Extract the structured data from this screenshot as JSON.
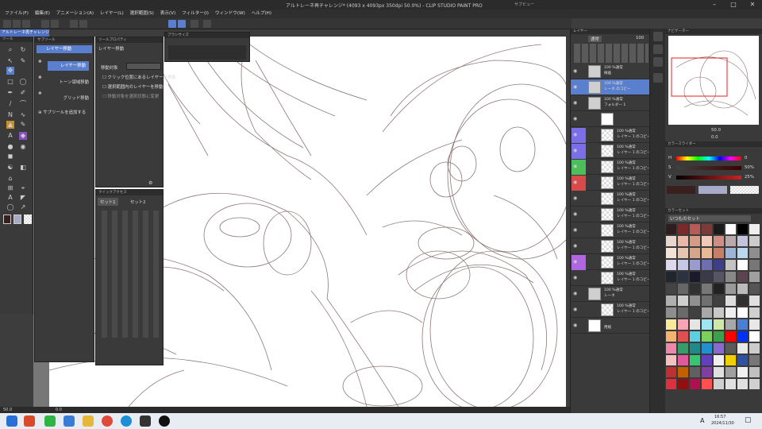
{
  "window": {
    "title": "アルトレーネ再チャレンジ* (4093 x 4093px 350dpi 50.0%)  - CLIP STUDIO PAINT PRO",
    "center_label": "サブビュー"
  },
  "menu": [
    "ファイル(F)",
    "編集(E)",
    "アニメーション(A)",
    "レイヤー(L)",
    "選択範囲(S)",
    "表示(V)",
    "フィルター(I)",
    "ウィンドウ(W)",
    "ヘルプ(H)"
  ],
  "doc_tab": {
    "label": "アルトレーネ再チャレンジ*"
  },
  "tool_panel": {
    "title": "ツール"
  },
  "subtool": {
    "title": "サブツール",
    "group": "レイヤー移動",
    "items": [
      "レイヤー移動",
      "トーン領域移動",
      "グリッド移動"
    ],
    "add": "サブツールを追加する"
  },
  "tool_property": {
    "title": "ツールプロパティ",
    "name": "レイヤー移動",
    "target_label": "移動対象",
    "options": [
      "クリック位置にあるレイヤーを移動",
      "選択範囲内のレイヤーを移動",
      "移動対象を選択状態に変更"
    ]
  },
  "quick_access": {
    "title": "クイックアクセス",
    "tabs": [
      "セット1",
      "セット2"
    ]
  },
  "brush_size": {
    "title": "ブラシサイズ"
  },
  "status": {
    "zoom": "50.0",
    "angle": "0.0"
  },
  "layers_panel": {
    "title": "レイヤー",
    "blend": "通常",
    "opacity": "100",
    "rows": [
      {
        "t1": "100 %通常",
        "t2": "線画",
        "type": "folder"
      },
      {
        "t1": "100 %通常",
        "t2": "レーネ のコピー",
        "type": "folder-selected"
      },
      {
        "t1": "100 %通常",
        "t2": "フォルダー 1",
        "type": "folder"
      },
      {
        "t1": "",
        "t2": "",
        "type": "mask"
      },
      {
        "t1": "100 %通常",
        "t2": "レイヤー 1 のコピー",
        "type": "layer",
        "color": "#7b6ee8"
      },
      {
        "t1": "100 %通常",
        "t2": "レイヤー 1 のコピー",
        "type": "layer",
        "color": "#7b6ee8"
      },
      {
        "t1": "100 %通常",
        "t2": "レイヤー 1 のコピー",
        "type": "layer",
        "color": "#4cbf5a"
      },
      {
        "t1": "100 %通常",
        "t2": "レイヤー 1 のコピー",
        "type": "layer",
        "color": "#d84a4a"
      },
      {
        "t1": "100 %通常",
        "t2": "レイヤー 1 のコピー",
        "type": "layer",
        "color": ""
      },
      {
        "t1": "100 %通常",
        "t2": "レイヤー 1 のコピー",
        "type": "layer",
        "color": ""
      },
      {
        "t1": "100 %通常",
        "t2": "レイヤー 1 のコピー",
        "type": "layer",
        "color": ""
      },
      {
        "t1": "100 %通常",
        "t2": "レイヤー 1 のコピー",
        "type": "layer",
        "color": ""
      },
      {
        "t1": "100 %通常",
        "t2": "レイヤー 1 のコピー",
        "type": "layer",
        "color": "#b066e0"
      },
      {
        "t1": "100 %通常",
        "t2": "レイヤー 1 のコピー 1",
        "type": "layer",
        "color": ""
      },
      {
        "t1": "100 %通常",
        "t2": "レーネ",
        "type": "folder"
      },
      {
        "t1": "100 %通常",
        "t2": "レイヤー 1 のコピー 4",
        "type": "layer",
        "color": ""
      },
      {
        "t1": "",
        "t2": "用紙",
        "type": "paper"
      }
    ]
  },
  "navigator": {
    "title": "ナビゲーター",
    "zoom": "50.0",
    "angle": "0.0"
  },
  "color_slider": {
    "title": "カラースライダー",
    "h_label": "H",
    "s_label": "S",
    "v_label": "V",
    "h": "0",
    "s": "50%",
    "v": "25%"
  },
  "color_set": {
    "title": "カラーセット",
    "name": "いつものセット",
    "colors": [
      "#2e1e1e",
      "#7a2a2a",
      "#b85a55",
      "#7a3b3b",
      "#1b1b1b",
      "#ffffff",
      "#000000",
      "#eeeeee",
      "#e9d6cf",
      "#e9b8a8",
      "#d69b86",
      "#f1c9b8",
      "#cf8e84",
      "#b9a9ad",
      "#c3c3de",
      "#cccccc",
      "#f3e2d6",
      "#e6c6b0",
      "#d6a58a",
      "#e8b897",
      "#c77d66",
      "#9db4d4",
      "#b9d8f0",
      "#8f8f8f",
      "#ddd8ec",
      "#c7c7e6",
      "#9b9bd0",
      "#6e6eb0",
      "#3e3e8a",
      "#c3c3c3",
      "#ffffff",
      "#777777",
      "#202530",
      "#2c3340",
      "#1a1a2a",
      "#3a3a4a",
      "#555566",
      "#888888",
      "#5b4350",
      "#a0a0a0",
      "#444444",
      "#666666",
      "#303030",
      "#777777",
      "#222222",
      "#999999",
      "#bbbbbb",
      "#555555",
      "#b0b0b0",
      "#cfcfcf",
      "#909090",
      "#707070",
      "#404040",
      "#dddddd",
      "#303030",
      "#e0e0e0",
      "#8e8e8e",
      "#6a6a6a",
      "#404040",
      "#a8a8a8",
      "#c8c8c8",
      "#eeeeee",
      "#ffffff",
      "#d0d0d0",
      "#fbe99a",
      "#f7a5b5",
      "#e5e5e5",
      "#9ee5f0",
      "#cfe9a5",
      "#a8a8a8",
      "#4a7fd8",
      "#e8e8e8",
      "#f3b26e",
      "#e05050",
      "#5ad0e0",
      "#7ad05a",
      "#3aa04a",
      "#ff0000",
      "#0030ff",
      "#ffffff",
      "#ee88aa",
      "#3a9a6a",
      "#1f8a8a",
      "#2090d0",
      "#8a6ad0",
      "#5a5a5a",
      "#e8e8e8",
      "#cccccc",
      "#f5c0c0",
      "#e05a9a",
      "#35c76f",
      "#6040c0",
      "#f0f0f0",
      "#f0d000",
      "#3050a0",
      "#777777",
      "#c03030",
      "#c06000",
      "#606060",
      "#8040a0",
      "#e0e0e0",
      "#a0a0a0",
      "#f0f0f0",
      "#c0c0c0",
      "#e03040",
      "#901010",
      "#b01050",
      "#ff5050",
      "#d0d0d0",
      "#e0e0e0",
      "#e0e0e0",
      "#d0d0d0"
    ]
  },
  "taskbar": {
    "time": "16:57",
    "date": "2024/11/30",
    "ime": "A"
  }
}
